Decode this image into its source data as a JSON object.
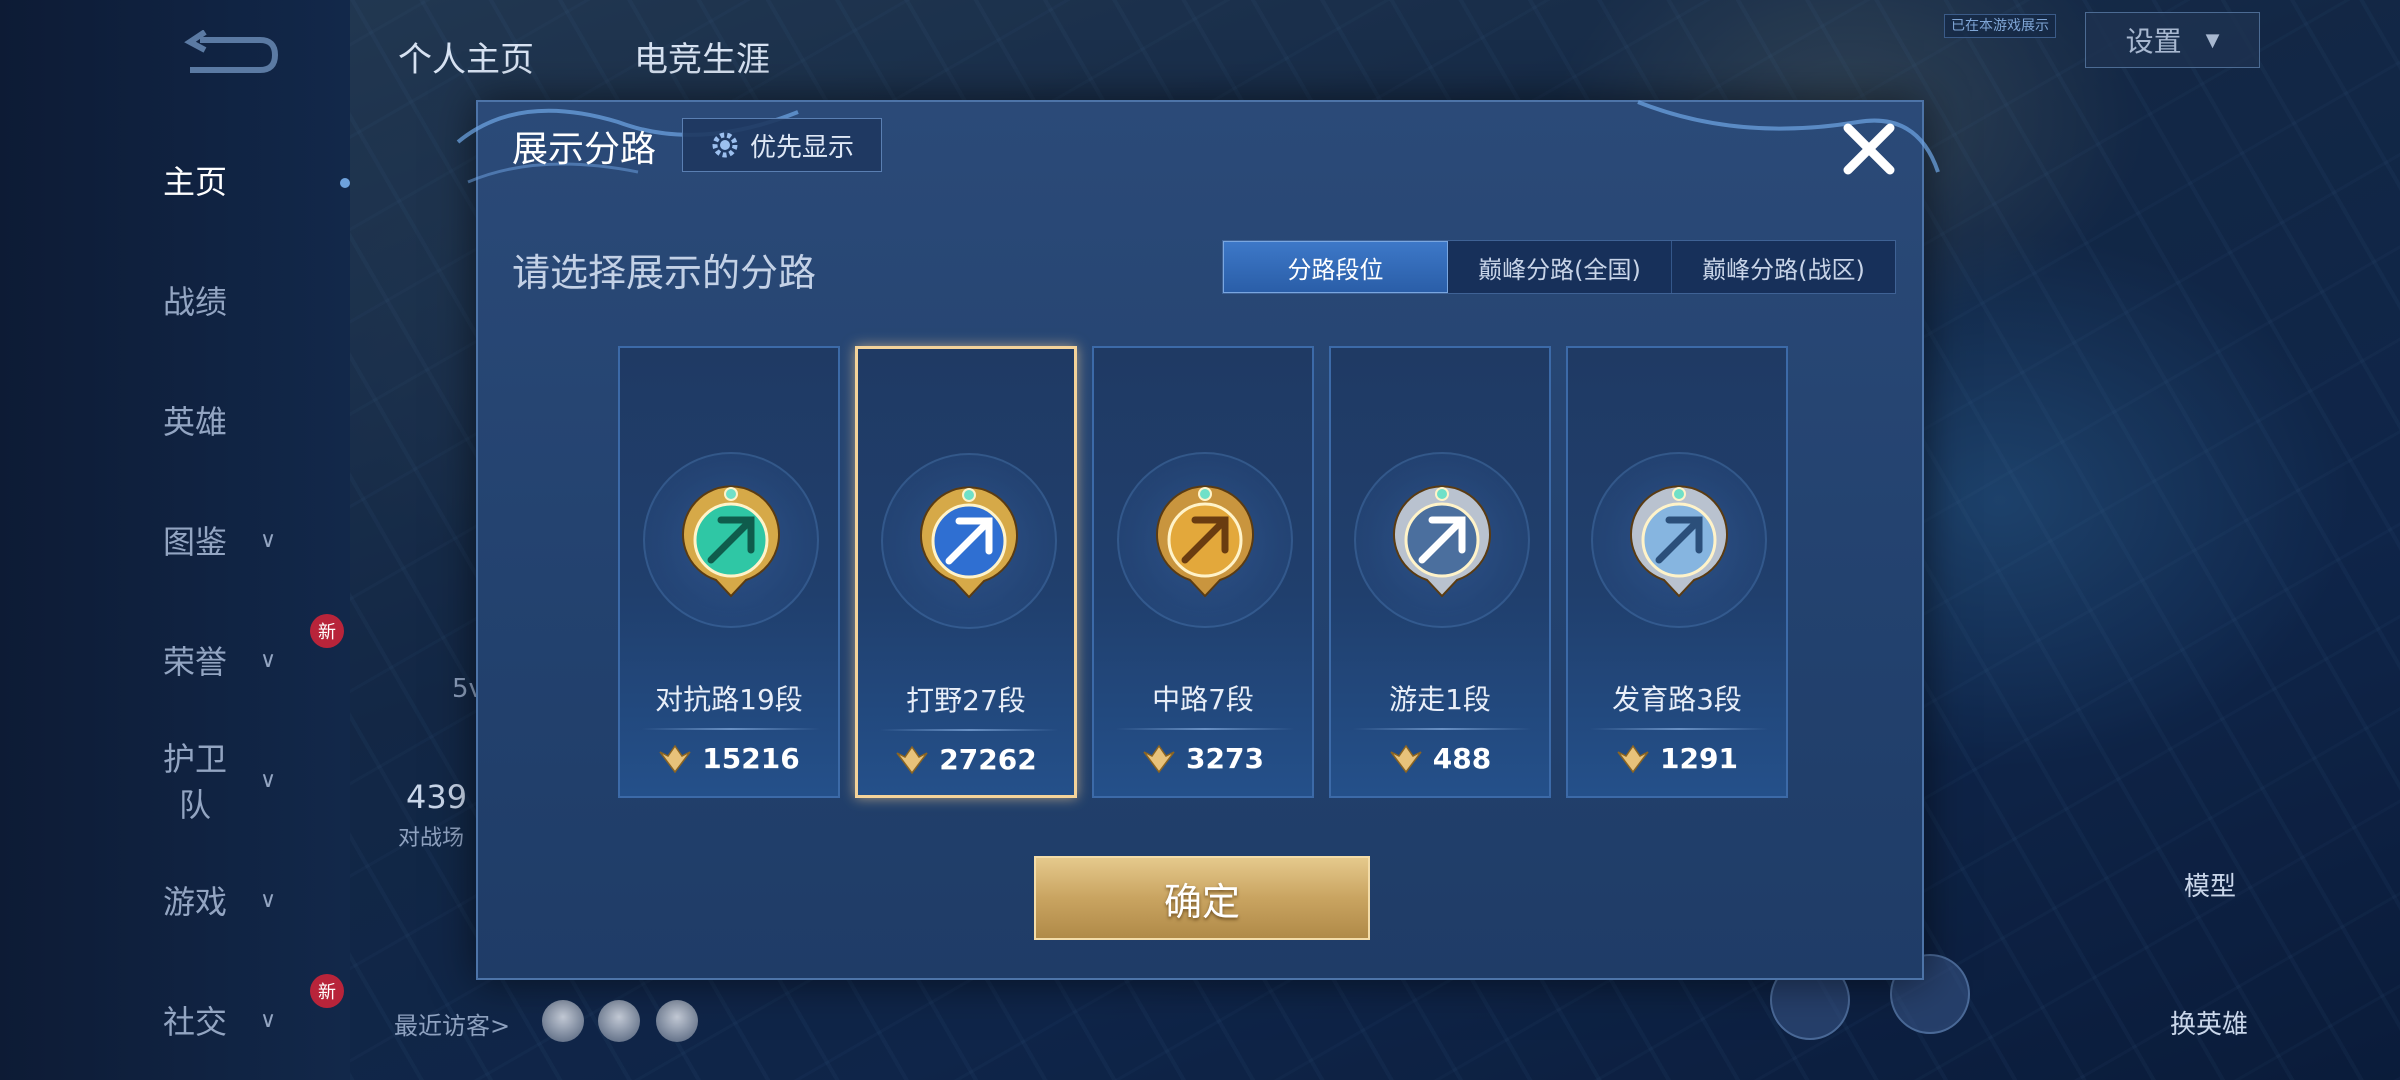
{
  "nav": {
    "items": [
      {
        "label": "主页",
        "active": true,
        "chevron": false,
        "new": false
      },
      {
        "label": "战绩",
        "active": false,
        "chevron": false,
        "new": false
      },
      {
        "label": "英雄",
        "active": false,
        "chevron": false,
        "new": false
      },
      {
        "label": "图鉴",
        "active": false,
        "chevron": true,
        "new": false
      },
      {
        "label": "荣誉",
        "active": false,
        "chevron": true,
        "new": true
      },
      {
        "label": "护卫队",
        "active": false,
        "chevron": true,
        "new": false
      },
      {
        "label": "游戏",
        "active": false,
        "chevron": true,
        "new": false
      },
      {
        "label": "社交",
        "active": false,
        "chevron": true,
        "new": true
      }
    ],
    "new_badge": "新"
  },
  "background": {
    "tabs": [
      "个人主页",
      "电竞生涯"
    ],
    "settings_label": "设置",
    "small_tag": "已在本游戏展示",
    "recent_visitors": "最近访客>",
    "stat_number": "439",
    "stat_label": "对战场",
    "partial_text": "5v",
    "model_label": "模型",
    "switch_hero_label": "换英雄"
  },
  "modal": {
    "title": "展示分路",
    "priority_label": "优先显示",
    "section_title": "请选择展示的分路",
    "filters": [
      "分路段位",
      "巅峰分路(全国)",
      "巅峰分路(战区)"
    ],
    "active_filter": 0,
    "lanes": [
      {
        "name": "对抗路19段",
        "power": "15216",
        "icon": "clash-lane-emblem-icon",
        "selected": false
      },
      {
        "name": "打野27段",
        "power": "27262",
        "icon": "jungle-emblem-icon",
        "selected": true
      },
      {
        "name": "中路7段",
        "power": "3273",
        "icon": "mid-lane-emblem-icon",
        "selected": false
      },
      {
        "name": "游走1段",
        "power": "488",
        "icon": "roam-emblem-icon",
        "selected": false
      },
      {
        "name": "发育路3段",
        "power": "1291",
        "icon": "farm-lane-emblem-icon",
        "selected": false
      }
    ],
    "confirm_label": "确定"
  },
  "colors": {
    "accent_blue": "#2a5ea8",
    "selected_gold": "#f4d39a",
    "confirm_gold": "#c9a461"
  }
}
